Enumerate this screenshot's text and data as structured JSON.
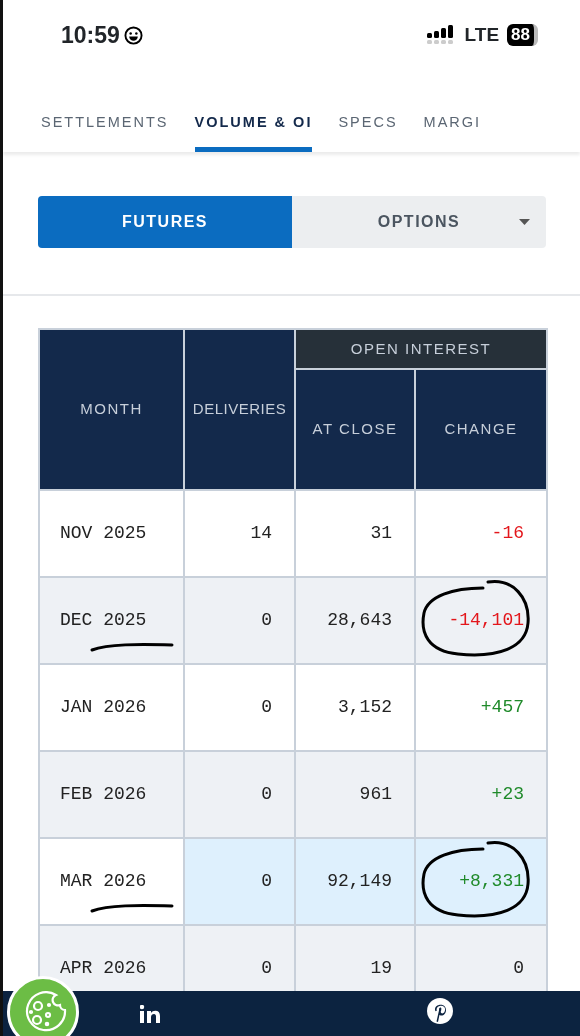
{
  "status_bar": {
    "time": "10:59",
    "network": "LTE",
    "battery": "88"
  },
  "tabs": [
    {
      "label": "SETTLEMENTS",
      "selected": false
    },
    {
      "label": "VOLUME & OI",
      "selected": true
    },
    {
      "label": "SPECS",
      "selected": false
    },
    {
      "label": "MARGI",
      "selected": false
    }
  ],
  "segments": [
    {
      "label": "FUTURES",
      "selected": true,
      "dropdown": false
    },
    {
      "label": "OPTIONS",
      "selected": false,
      "dropdown": true
    }
  ],
  "table": {
    "group_header": "OPEN INTEREST",
    "columns": [
      "MONTH",
      "DELIVERIES",
      "AT CLOSE",
      "CHANGE"
    ],
    "rows": [
      {
        "month": "NOV 2025",
        "deliveries": "14",
        "at_close": "31",
        "change": "-16",
        "color": "#e3161b",
        "highlighted": false,
        "underlined": false,
        "circled": false
      },
      {
        "month": "DEC 2025",
        "deliveries": "0",
        "at_close": "28,643",
        "change": "-14,101",
        "color": "#e3161b",
        "highlighted": false,
        "underlined": true,
        "circled": true
      },
      {
        "month": "JAN 2026",
        "deliveries": "0",
        "at_close": "3,152",
        "change": "+457",
        "color": "#1f8a2a",
        "highlighted": false,
        "underlined": false,
        "circled": false
      },
      {
        "month": "FEB 2026",
        "deliveries": "0",
        "at_close": "961",
        "change": "+23",
        "color": "#1f8a2a",
        "highlighted": false,
        "underlined": false,
        "circled": false
      },
      {
        "month": "MAR 2026",
        "deliveries": "0",
        "at_close": "92,149",
        "change": "+8,331",
        "color": "#1f8a2a",
        "highlighted": true,
        "underlined": true,
        "circled": true
      },
      {
        "month": "APR 2026",
        "deliveries": "0",
        "at_close": "19",
        "change": "0",
        "color": "#222222",
        "highlighted": false,
        "underlined": false,
        "circled": false
      }
    ]
  }
}
